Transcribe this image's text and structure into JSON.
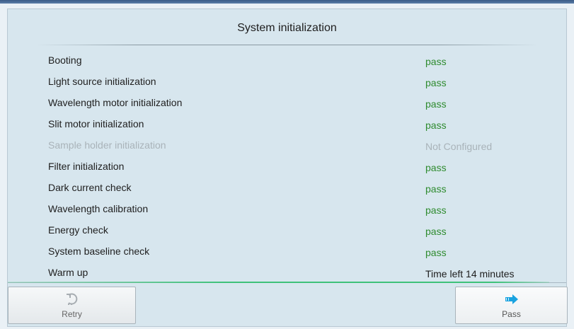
{
  "dialog": {
    "title": "System initialization"
  },
  "items": [
    {
      "label": "Booting",
      "status": "pass",
      "state": "pass"
    },
    {
      "label": "Light source initialization",
      "status": "pass",
      "state": "pass"
    },
    {
      "label": "Wavelength motor initialization",
      "status": "pass",
      "state": "pass"
    },
    {
      "label": "Slit motor initialization",
      "status": "pass",
      "state": "pass"
    },
    {
      "label": "Sample holder initialization",
      "status": "Not Configured",
      "state": "disabled"
    },
    {
      "label": "Filter initialization",
      "status": "pass",
      "state": "pass"
    },
    {
      "label": "Dark current check",
      "status": "pass",
      "state": "pass"
    },
    {
      "label": "Wavelength calibration",
      "status": "pass",
      "state": "pass"
    },
    {
      "label": "Energy check",
      "status": "pass",
      "state": "pass"
    },
    {
      "label": "System baseline check",
      "status": "pass",
      "state": "pass"
    },
    {
      "label": "Warm up",
      "status": "Time left  14 minutes",
      "state": "timer"
    }
  ],
  "progress": {
    "fraction": 0.97
  },
  "buttons": {
    "retry_label": "Retry",
    "retry_icon": "undo-icon",
    "pass_label": "Pass",
    "pass_icon": "arrow-right-icon"
  },
  "colors": {
    "pass": "#2e8b2e",
    "disabled": "#a9b3b9",
    "accent": "#1aa3e0"
  }
}
